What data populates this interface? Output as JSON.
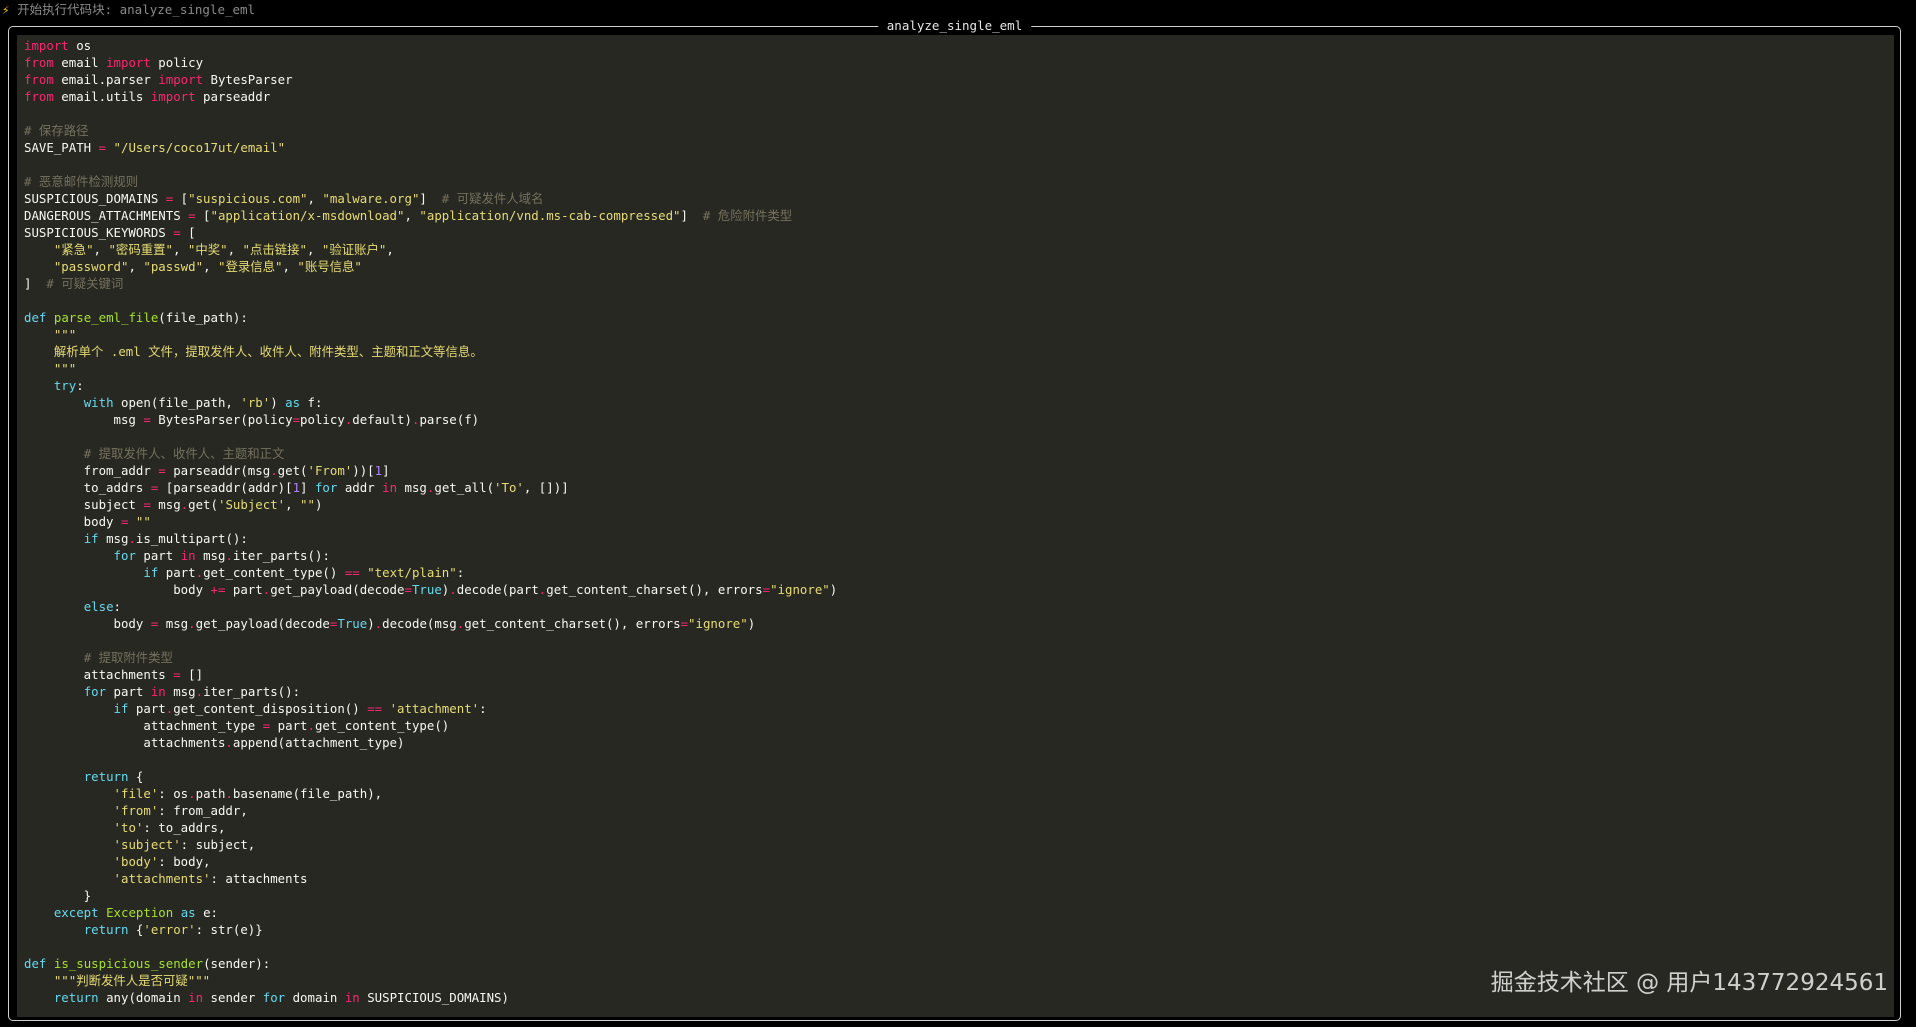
{
  "header": {
    "icon": "lightning-icon",
    "text": "开始执行代码块: analyze_single_eml"
  },
  "panel": {
    "title": "analyze_single_eml"
  },
  "colors": {
    "kw": "#f92672",
    "str": "#e6db74",
    "com": "#75715e",
    "fn": "#a6e22e",
    "blue": "#66d9ef",
    "num": "#ae81ff",
    "txt": "#f8f8f2",
    "background": "#272822"
  },
  "code": [
    [
      [
        "kw",
        "import"
      ],
      [
        "txt",
        " os"
      ]
    ],
    [
      [
        "kw",
        "from"
      ],
      [
        "txt",
        " email "
      ],
      [
        "kw",
        "import"
      ],
      [
        "txt",
        " policy"
      ]
    ],
    [
      [
        "kw",
        "from"
      ],
      [
        "txt",
        " email.parser "
      ],
      [
        "kw",
        "import"
      ],
      [
        "txt",
        " BytesParser"
      ]
    ],
    [
      [
        "kw",
        "from"
      ],
      [
        "txt",
        " email.utils "
      ],
      [
        "kw",
        "import"
      ],
      [
        "txt",
        " parseaddr"
      ]
    ],
    [],
    [
      [
        "com",
        "# 保存路径"
      ]
    ],
    [
      [
        "txt",
        "SAVE_PATH "
      ],
      [
        "kw",
        "="
      ],
      [
        "txt",
        " "
      ],
      [
        "str",
        "\"/Users/coco17ut/email\""
      ]
    ],
    [],
    [
      [
        "com",
        "# 恶意邮件检测规则"
      ]
    ],
    [
      [
        "txt",
        "SUSPICIOUS_DOMAINS "
      ],
      [
        "kw",
        "="
      ],
      [
        "txt",
        " ["
      ],
      [
        "str",
        "\"suspicious.com\""
      ],
      [
        "txt",
        ", "
      ],
      [
        "str",
        "\"malware.org\""
      ],
      [
        "txt",
        "]  "
      ],
      [
        "com",
        "# 可疑发件人域名"
      ]
    ],
    [
      [
        "txt",
        "DANGEROUS_ATTACHMENTS "
      ],
      [
        "kw",
        "="
      ],
      [
        "txt",
        " ["
      ],
      [
        "str",
        "\"application/x-msdownload\""
      ],
      [
        "txt",
        ", "
      ],
      [
        "str",
        "\"application/vnd.ms-cab-compressed\""
      ],
      [
        "txt",
        "]  "
      ],
      [
        "com",
        "# 危险附件类型"
      ]
    ],
    [
      [
        "txt",
        "SUSPICIOUS_KEYWORDS "
      ],
      [
        "kw",
        "="
      ],
      [
        "txt",
        " ["
      ]
    ],
    [
      [
        "txt",
        "    "
      ],
      [
        "str",
        "\"紧急\""
      ],
      [
        "txt",
        ", "
      ],
      [
        "str",
        "\"密码重置\""
      ],
      [
        "txt",
        ", "
      ],
      [
        "str",
        "\"中奖\""
      ],
      [
        "txt",
        ", "
      ],
      [
        "str",
        "\"点击链接\""
      ],
      [
        "txt",
        ", "
      ],
      [
        "str",
        "\"验证账户\""
      ],
      [
        "txt",
        ","
      ]
    ],
    [
      [
        "txt",
        "    "
      ],
      [
        "str",
        "\"password\""
      ],
      [
        "txt",
        ", "
      ],
      [
        "str",
        "\"passwd\""
      ],
      [
        "txt",
        ", "
      ],
      [
        "str",
        "\"登录信息\""
      ],
      [
        "txt",
        ", "
      ],
      [
        "str",
        "\"账号信息\""
      ]
    ],
    [
      [
        "txt",
        "]  "
      ],
      [
        "com",
        "# 可疑关键词"
      ]
    ],
    [],
    [
      [
        "blue",
        "def"
      ],
      [
        "txt",
        " "
      ],
      [
        "fn",
        "parse_eml_file"
      ],
      [
        "txt",
        "(file_path):"
      ]
    ],
    [
      [
        "txt",
        "    "
      ],
      [
        "str",
        "\"\"\""
      ]
    ],
    [
      [
        "txt",
        "    "
      ],
      [
        "str",
        "解析单个 .eml 文件，提取发件人、收件人、附件类型、主题和正文等信息。"
      ]
    ],
    [
      [
        "txt",
        "    "
      ],
      [
        "str",
        "\"\"\""
      ]
    ],
    [
      [
        "txt",
        "    "
      ],
      [
        "blue",
        "try"
      ],
      [
        "txt",
        ":"
      ]
    ],
    [
      [
        "txt",
        "        "
      ],
      [
        "blue",
        "with"
      ],
      [
        "txt",
        " open(file_path, "
      ],
      [
        "str",
        "'rb'"
      ],
      [
        "txt",
        ") "
      ],
      [
        "blue",
        "as"
      ],
      [
        "txt",
        " f:"
      ]
    ],
    [
      [
        "txt",
        "            msg "
      ],
      [
        "kw",
        "="
      ],
      [
        "txt",
        " BytesParser(policy"
      ],
      [
        "kw",
        "="
      ],
      [
        "txt",
        "policy"
      ],
      [
        "kw",
        "."
      ],
      [
        "txt",
        "default)"
      ],
      [
        "kw",
        "."
      ],
      [
        "txt",
        "parse(f)"
      ]
    ],
    [],
    [
      [
        "txt",
        "        "
      ],
      [
        "com",
        "# 提取发件人、收件人、主题和正文"
      ]
    ],
    [
      [
        "txt",
        "        from_addr "
      ],
      [
        "kw",
        "="
      ],
      [
        "txt",
        " parseaddr(msg"
      ],
      [
        "kw",
        "."
      ],
      [
        "txt",
        "get("
      ],
      [
        "str",
        "'From'"
      ],
      [
        "txt",
        "))["
      ],
      [
        "num",
        "1"
      ],
      [
        "txt",
        "]"
      ]
    ],
    [
      [
        "txt",
        "        to_addrs "
      ],
      [
        "kw",
        "="
      ],
      [
        "txt",
        " [parseaddr(addr)["
      ],
      [
        "num",
        "1"
      ],
      [
        "txt",
        "] "
      ],
      [
        "blue",
        "for"
      ],
      [
        "txt",
        " addr "
      ],
      [
        "kw",
        "in"
      ],
      [
        "txt",
        " msg"
      ],
      [
        "kw",
        "."
      ],
      [
        "txt",
        "get_all("
      ],
      [
        "str",
        "'To'"
      ],
      [
        "txt",
        ", [])]"
      ]
    ],
    [
      [
        "txt",
        "        subject "
      ],
      [
        "kw",
        "="
      ],
      [
        "txt",
        " msg"
      ],
      [
        "kw",
        "."
      ],
      [
        "txt",
        "get("
      ],
      [
        "str",
        "'Subject'"
      ],
      [
        "txt",
        ", "
      ],
      [
        "str",
        "\"\""
      ],
      [
        "txt",
        ")"
      ]
    ],
    [
      [
        "txt",
        "        body "
      ],
      [
        "kw",
        "="
      ],
      [
        "txt",
        " "
      ],
      [
        "str",
        "\"\""
      ]
    ],
    [
      [
        "txt",
        "        "
      ],
      [
        "blue",
        "if"
      ],
      [
        "txt",
        " msg"
      ],
      [
        "kw",
        "."
      ],
      [
        "txt",
        "is_multipart():"
      ]
    ],
    [
      [
        "txt",
        "            "
      ],
      [
        "blue",
        "for"
      ],
      [
        "txt",
        " part "
      ],
      [
        "kw",
        "in"
      ],
      [
        "txt",
        " msg"
      ],
      [
        "kw",
        "."
      ],
      [
        "txt",
        "iter_parts():"
      ]
    ],
    [
      [
        "txt",
        "                "
      ],
      [
        "blue",
        "if"
      ],
      [
        "txt",
        " part"
      ],
      [
        "kw",
        "."
      ],
      [
        "txt",
        "get_content_type() "
      ],
      [
        "kw",
        "=="
      ],
      [
        "txt",
        " "
      ],
      [
        "str",
        "\"text/plain\""
      ],
      [
        "txt",
        ":"
      ]
    ],
    [
      [
        "txt",
        "                    body "
      ],
      [
        "kw",
        "+="
      ],
      [
        "txt",
        " part"
      ],
      [
        "kw",
        "."
      ],
      [
        "txt",
        "get_payload(decode"
      ],
      [
        "kw",
        "="
      ],
      [
        "blue",
        "True"
      ],
      [
        "txt",
        ")"
      ],
      [
        "kw",
        "."
      ],
      [
        "txt",
        "decode(part"
      ],
      [
        "kw",
        "."
      ],
      [
        "txt",
        "get_content_charset(), errors"
      ],
      [
        "kw",
        "="
      ],
      [
        "str",
        "\"ignore\""
      ],
      [
        "txt",
        ")"
      ]
    ],
    [
      [
        "txt",
        "        "
      ],
      [
        "blue",
        "else"
      ],
      [
        "txt",
        ":"
      ]
    ],
    [
      [
        "txt",
        "            body "
      ],
      [
        "kw",
        "="
      ],
      [
        "txt",
        " msg"
      ],
      [
        "kw",
        "."
      ],
      [
        "txt",
        "get_payload(decode"
      ],
      [
        "kw",
        "="
      ],
      [
        "blue",
        "True"
      ],
      [
        "txt",
        ")"
      ],
      [
        "kw",
        "."
      ],
      [
        "txt",
        "decode(msg"
      ],
      [
        "kw",
        "."
      ],
      [
        "txt",
        "get_content_charset(), errors"
      ],
      [
        "kw",
        "="
      ],
      [
        "str",
        "\"ignore\""
      ],
      [
        "txt",
        ")"
      ]
    ],
    [],
    [
      [
        "txt",
        "        "
      ],
      [
        "com",
        "# 提取附件类型"
      ]
    ],
    [
      [
        "txt",
        "        attachments "
      ],
      [
        "kw",
        "="
      ],
      [
        "txt",
        " []"
      ]
    ],
    [
      [
        "txt",
        "        "
      ],
      [
        "blue",
        "for"
      ],
      [
        "txt",
        " part "
      ],
      [
        "kw",
        "in"
      ],
      [
        "txt",
        " msg"
      ],
      [
        "kw",
        "."
      ],
      [
        "txt",
        "iter_parts():"
      ]
    ],
    [
      [
        "txt",
        "            "
      ],
      [
        "blue",
        "if"
      ],
      [
        "txt",
        " part"
      ],
      [
        "kw",
        "."
      ],
      [
        "txt",
        "get_content_disposition() "
      ],
      [
        "kw",
        "=="
      ],
      [
        "txt",
        " "
      ],
      [
        "str",
        "'attachment'"
      ],
      [
        "txt",
        ":"
      ]
    ],
    [
      [
        "txt",
        "                attachment_type "
      ],
      [
        "kw",
        "="
      ],
      [
        "txt",
        " part"
      ],
      [
        "kw",
        "."
      ],
      [
        "txt",
        "get_content_type()"
      ]
    ],
    [
      [
        "txt",
        "                attachments"
      ],
      [
        "kw",
        "."
      ],
      [
        "txt",
        "append(attachment_type)"
      ]
    ],
    [],
    [
      [
        "txt",
        "        "
      ],
      [
        "blue",
        "return"
      ],
      [
        "txt",
        " {"
      ]
    ],
    [
      [
        "txt",
        "            "
      ],
      [
        "str",
        "'file'"
      ],
      [
        "txt",
        ": os"
      ],
      [
        "kw",
        "."
      ],
      [
        "txt",
        "path"
      ],
      [
        "kw",
        "."
      ],
      [
        "txt",
        "basename(file_path),"
      ]
    ],
    [
      [
        "txt",
        "            "
      ],
      [
        "str",
        "'from'"
      ],
      [
        "txt",
        ": from_addr,"
      ]
    ],
    [
      [
        "txt",
        "            "
      ],
      [
        "str",
        "'to'"
      ],
      [
        "txt",
        ": to_addrs,"
      ]
    ],
    [
      [
        "txt",
        "            "
      ],
      [
        "str",
        "'subject'"
      ],
      [
        "txt",
        ": subject,"
      ]
    ],
    [
      [
        "txt",
        "            "
      ],
      [
        "str",
        "'body'"
      ],
      [
        "txt",
        ": body,"
      ]
    ],
    [
      [
        "txt",
        "            "
      ],
      [
        "str",
        "'attachments'"
      ],
      [
        "txt",
        ": attachments"
      ]
    ],
    [
      [
        "txt",
        "        }"
      ]
    ],
    [
      [
        "txt",
        "    "
      ],
      [
        "blue",
        "except"
      ],
      [
        "txt",
        " "
      ],
      [
        "fn",
        "Exception"
      ],
      [
        "txt",
        " "
      ],
      [
        "blue",
        "as"
      ],
      [
        "txt",
        " e:"
      ]
    ],
    [
      [
        "txt",
        "        "
      ],
      [
        "blue",
        "return"
      ],
      [
        "txt",
        " {"
      ],
      [
        "str",
        "'error'"
      ],
      [
        "txt",
        ": str(e)}"
      ]
    ],
    [],
    [
      [
        "blue",
        "def"
      ],
      [
        "txt",
        " "
      ],
      [
        "fn",
        "is_suspicious_sender"
      ],
      [
        "txt",
        "(sender):"
      ]
    ],
    [
      [
        "txt",
        "    "
      ],
      [
        "str",
        "\"\"\"判断发件人是否可疑\"\"\""
      ]
    ],
    [
      [
        "txt",
        "    "
      ],
      [
        "blue",
        "return"
      ],
      [
        "txt",
        " any(domain "
      ],
      [
        "kw",
        "in"
      ],
      [
        "txt",
        " sender "
      ],
      [
        "blue",
        "for"
      ],
      [
        "txt",
        " domain "
      ],
      [
        "kw",
        "in"
      ],
      [
        "txt",
        " SUSPICIOUS_DOMAINS)"
      ]
    ]
  ],
  "watermark": "掘金技术社区 @ 用户143772924561"
}
